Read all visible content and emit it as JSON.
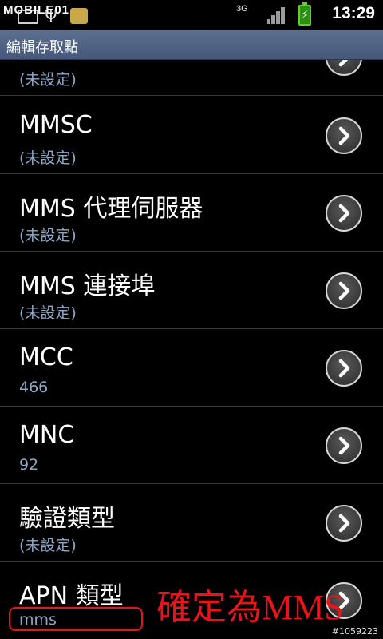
{
  "status_bar": {
    "watermark": "MOBILE01",
    "network": "3G",
    "time": "13:29",
    "icons": [
      "mail-icon",
      "usb-icon",
      "app-notification-icon",
      "signal-icon",
      "battery-charging-icon"
    ]
  },
  "header": {
    "title": "編輯存取點"
  },
  "rows": [
    {
      "title": "",
      "summary": "(未設定)"
    },
    {
      "title": "MMSC",
      "summary": "(未設定)"
    },
    {
      "title": "MMS 代理伺服器",
      "summary": "(未設定)"
    },
    {
      "title": "MMS 連接埠",
      "summary": "(未設定)"
    },
    {
      "title": "MCC",
      "summary": "466"
    },
    {
      "title": "MNC",
      "summary": "92"
    },
    {
      "title": "驗證類型",
      "summary": "(未設定)"
    },
    {
      "title": "APN 類型",
      "summary": "mms"
    }
  ],
  "annotation": {
    "text": "確定為MMS",
    "color": "#e8141a"
  },
  "photo_id": "#1059223",
  "colors": {
    "header_bg": "#5c6f8e",
    "summary_text": "#8fa9c8",
    "battery": "#5fd12a"
  }
}
